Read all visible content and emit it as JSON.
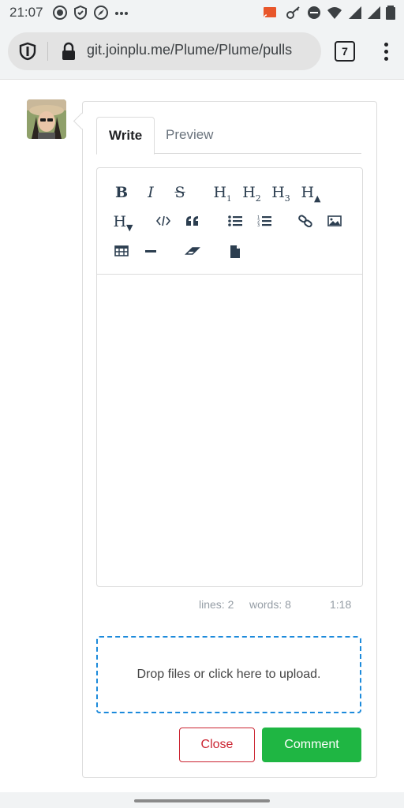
{
  "status_bar": {
    "time": "21:07",
    "left_icons": [
      "record-icon",
      "shield-check-icon",
      "compass-icon",
      "more-dots-icon"
    ],
    "right_icons": [
      "cast-icon",
      "key-icon",
      "do-not-disturb-icon",
      "wifi-icon",
      "signal-icon",
      "battery-icon"
    ]
  },
  "browser": {
    "url": "git.joinplu.me/Plume/Plume/pulls",
    "tab_count": "7"
  },
  "comment_form": {
    "tabs": [
      {
        "label": "Write",
        "active": true
      },
      {
        "label": "Preview",
        "active": false
      }
    ],
    "toolbar": [
      {
        "name": "bold-icon",
        "glyph": "B"
      },
      {
        "name": "italic-icon",
        "glyph": "I"
      },
      {
        "name": "strikethrough-icon",
        "glyph": "S"
      },
      {
        "name": "heading-1-icon",
        "glyph": "H",
        "sub": "1"
      },
      {
        "name": "heading-2-icon",
        "glyph": "H",
        "sub": "2"
      },
      {
        "name": "heading-3-icon",
        "glyph": "H",
        "sub": "3"
      },
      {
        "name": "heading-bigger-icon",
        "glyph": "H",
        "sub": "▲"
      },
      {
        "name": "heading-smaller-icon",
        "glyph": "H",
        "sub": "▼"
      },
      {
        "name": "code-icon"
      },
      {
        "name": "quote-icon"
      },
      {
        "name": "unordered-list-icon"
      },
      {
        "name": "ordered-list-icon"
      },
      {
        "name": "link-icon"
      },
      {
        "name": "image-icon"
      },
      {
        "name": "table-icon"
      },
      {
        "name": "horizontal-rule-icon"
      },
      {
        "name": "eraser-icon"
      },
      {
        "name": "file-icon"
      }
    ],
    "editor_value": "",
    "status": {
      "lines": "lines: 2",
      "words": "words: 8",
      "cursor": "1:18"
    },
    "dropzone_text": "Drop files or click here to upload.",
    "close_label": "Close",
    "comment_label": "Comment"
  },
  "colors": {
    "accent_blue": "#1c8adb",
    "comment_green": "#1fb643",
    "close_red": "#cb2431"
  }
}
